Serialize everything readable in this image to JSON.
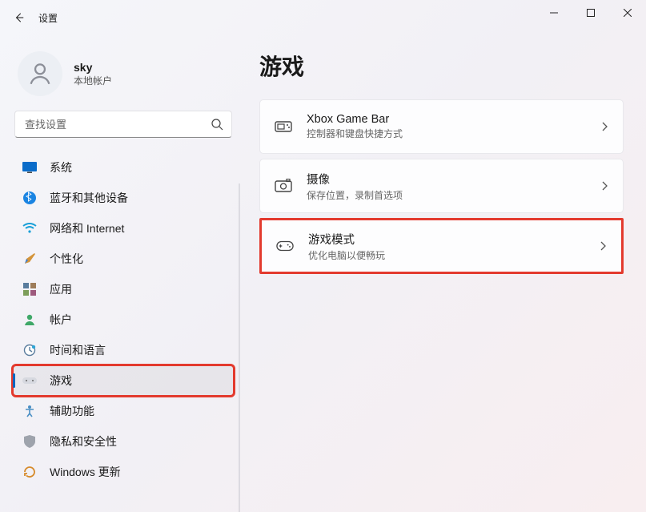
{
  "window": {
    "title": "设置"
  },
  "profile": {
    "name": "sky",
    "account_type": "本地帐户"
  },
  "search": {
    "placeholder": "查找设置"
  },
  "nav": {
    "items": [
      {
        "id": "system",
        "label": "系统"
      },
      {
        "id": "bluetooth",
        "label": "蓝牙和其他设备"
      },
      {
        "id": "network",
        "label": "网络和 Internet"
      },
      {
        "id": "personalize",
        "label": "个性化"
      },
      {
        "id": "apps",
        "label": "应用"
      },
      {
        "id": "accounts",
        "label": "帐户"
      },
      {
        "id": "time",
        "label": "时间和语言"
      },
      {
        "id": "gaming",
        "label": "游戏"
      },
      {
        "id": "accessibility",
        "label": "辅助功能"
      },
      {
        "id": "privacy",
        "label": "隐私和安全性"
      },
      {
        "id": "update",
        "label": "Windows 更新"
      }
    ],
    "selected": "gaming"
  },
  "main": {
    "title": "游戏",
    "cards": [
      {
        "id": "xbox-game-bar",
        "title": "Xbox Game Bar",
        "subtitle": "控制器和键盘快捷方式"
      },
      {
        "id": "captures",
        "title": "摄像",
        "subtitle": "保存位置，录制首选项"
      },
      {
        "id": "game-mode",
        "title": "游戏模式",
        "subtitle": "优化电脑以便畅玩"
      }
    ],
    "highlighted": "game-mode"
  }
}
